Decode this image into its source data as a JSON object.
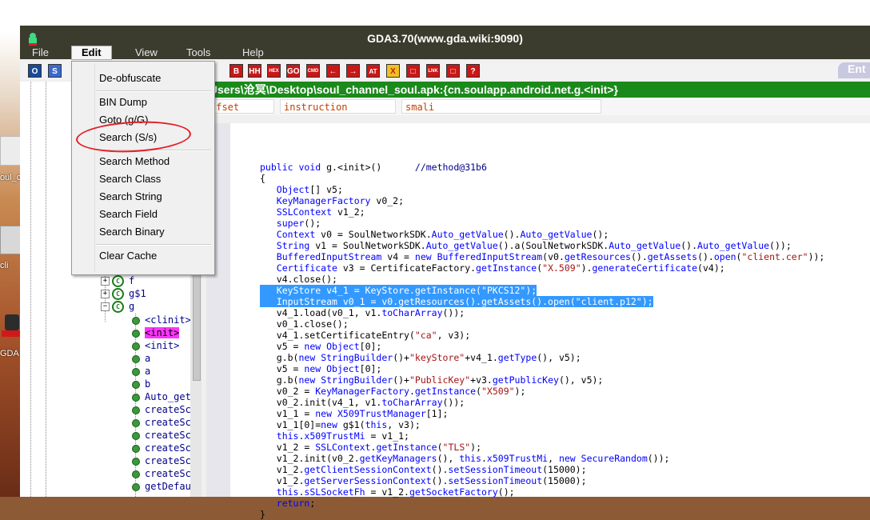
{
  "window": {
    "title": "GDA3.70(www.gda.wiki:9090)"
  },
  "menubar": {
    "file": "File",
    "edit": "Edit",
    "view": "View",
    "tools": "Tools",
    "help": "Help"
  },
  "desktop": {
    "label1": "oul_ch",
    "label2": "cli",
    "label3": "GDA"
  },
  "toolbar": {
    "buttons": [
      "O",
      "S",
      "B",
      "HH",
      "HEX",
      "GO",
      "CMD",
      "←",
      "→",
      "AT",
      "X",
      "□",
      "LNK",
      "□",
      "?"
    ],
    "right_tab": "Ent"
  },
  "pathbar": {
    "path": "\\Users\\沧冥\\Desktop\\soul_channel_soul.apk:{cn.soulapp.android.net.g.<init>}"
  },
  "columns": {
    "offset": "ffset",
    "instruction": "instruction",
    "smali": "smali"
  },
  "edit_menu": {
    "items": [
      "De-obfuscate",
      "BIN Dump",
      "Goto (g/G)",
      "Search (S/s)",
      "Search Method",
      "Search Class",
      "Search String",
      "Search Field",
      "Search Binary",
      "Clear Cache"
    ]
  },
  "tree": {
    "classes": [
      "f",
      "g$1",
      "g"
    ],
    "methods": [
      "<clinit>",
      "<init>",
      "<init>",
      "a",
      "a",
      "b",
      "Auto_get",
      "createSc",
      "createSc",
      "createSc",
      "createSc",
      "createSc",
      "createSc",
      "getDefau"
    ]
  },
  "code": {
    "lines": [
      "public void g.<init>()      //method@31b6",
      "{",
      "   Object[] v5;",
      "   KeyManagerFactory v0_2;",
      "   SSLContext v1_2;",
      "   super();",
      "   Context v0 = SoulNetworkSDK.Auto_getValue().Auto_getValue();",
      "   String v1 = SoulNetworkSDK.Auto_getValue().a(SoulNetworkSDK.Auto_getValue().Auto_getValue());",
      "   BufferedInputStream v4 = new BufferedInputStream(v0.getResources().getAssets().open(\"client.cer\"));",
      "   Certificate v3 = CertificateFactory.getInstance(\"X.509\").generateCertificate(v4);",
      "   v4.close();",
      "   KeyStore v4_1 = KeyStore.getInstance(\"PKCS12\");",
      "   InputStream v0_1 = v0.getResources().getAssets().open(\"client.p12\");",
      "   v4_1.load(v0_1, v1.toCharArray());",
      "   v0_1.close();",
      "   v4_1.setCertificateEntry(\"ca\", v3);",
      "   v5 = new Object[0];",
      "   g.b(new StringBuilder()+\"keyStore\"+v4_1.getType(), v5);",
      "   v5 = new Object[0];",
      "   g.b(new StringBuilder()+\"PublicKey\"+v3.getPublicKey(), v5);",
      "   v0_2 = KeyManagerFactory.getInstance(\"X509\");",
      "   v0_2.init(v4_1, v1.toCharArray());",
      "   v1_1 = new X509TrustManager[1];",
      "   v1_1[0]=new g$1(this, v3);",
      "   this.x509TrustMi = v1_1;",
      "   v1_2 = SSLContext.getInstance(\"TLS\");",
      "   v1_2.init(v0_2.getKeyManagers(), this.x509TrustMi, new SecureRandom());",
      "   v1_2.getClientSessionContext().setSessionTimeout(15000);",
      "   v1_2.getServerSessionContext().setSessionTimeout(15000);",
      "   this.sSLSocketFh = v1_2.getSocketFactory();",
      "   return;",
      "}"
    ]
  },
  "colors": {
    "keyword": "#0000ff",
    "string": "#a31515",
    "highlight": "#ff33ff",
    "selection": "#3399ff",
    "pathbar": "#1a8a1a",
    "annotation": "#e41e26"
  }
}
